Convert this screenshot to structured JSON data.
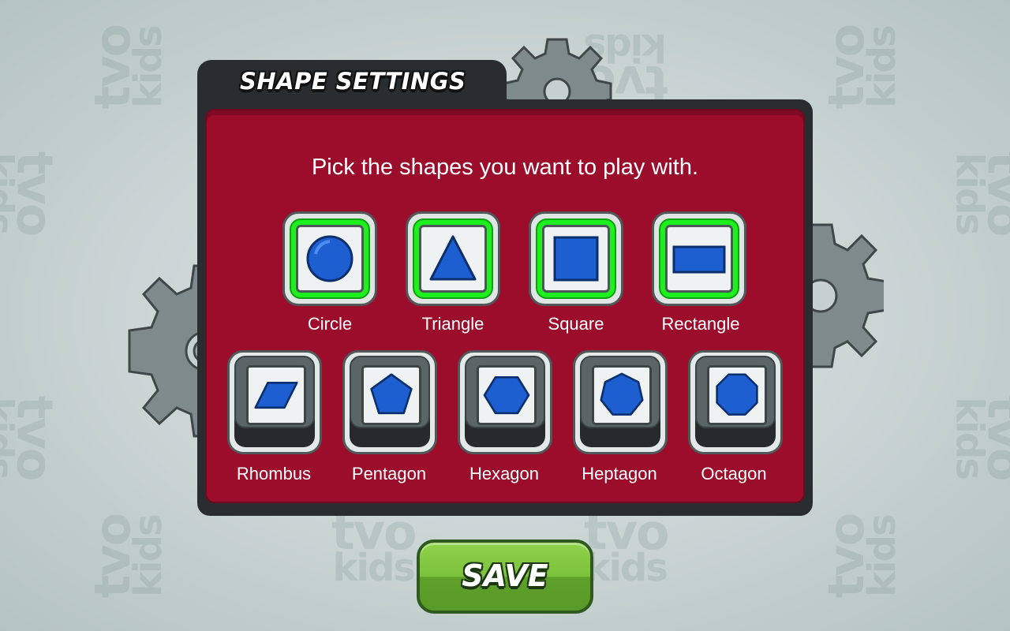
{
  "watermark": {
    "line1": "tvo",
    "line2": "kids"
  },
  "panel": {
    "title": "SHAPE SETTINGS",
    "instruction": "Pick the shapes you want to play with."
  },
  "shapes": [
    {
      "label": "Circle",
      "selected": true,
      "icon": "circle-icon"
    },
    {
      "label": "Triangle",
      "selected": true,
      "icon": "triangle-icon"
    },
    {
      "label": "Square",
      "selected": true,
      "icon": "square-icon"
    },
    {
      "label": "Rectangle",
      "selected": true,
      "icon": "rectangle-icon"
    },
    {
      "label": "Rhombus",
      "selected": false,
      "icon": "rhombus-icon"
    },
    {
      "label": "Pentagon",
      "selected": false,
      "icon": "pentagon-icon"
    },
    {
      "label": "Hexagon",
      "selected": false,
      "icon": "hexagon-icon"
    },
    {
      "label": "Heptagon",
      "selected": false,
      "icon": "heptagon-icon"
    },
    {
      "label": "Octagon",
      "selected": false,
      "icon": "octagon-icon"
    }
  ],
  "save_button": {
    "label": "SAVE"
  },
  "colors": {
    "panel_red": "#9c0d2c",
    "selected_green": "#1ef01e",
    "shape_blue": "#1d5fd0",
    "save_green": "#7cc23c"
  }
}
